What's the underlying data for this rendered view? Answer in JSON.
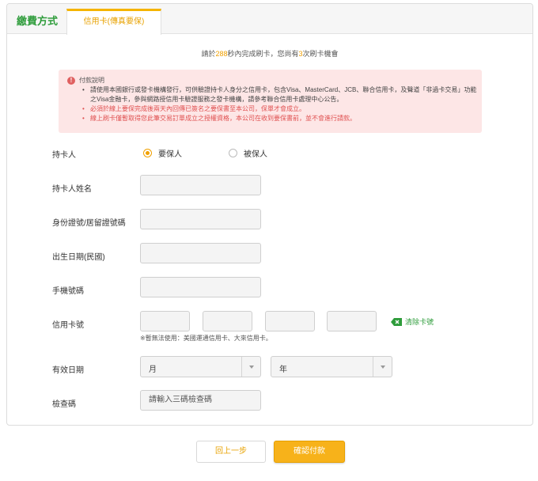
{
  "header": {
    "title": "繳費方式",
    "active_tab": "信用卡(傳真要保)"
  },
  "countdown": {
    "prefix": "請於",
    "seconds": "288",
    "middle": "秒內完成刷卡，您尚有",
    "attempts": "3",
    "suffix": "次刷卡機會"
  },
  "notice": {
    "icon": "exclamation-icon",
    "title": "付款說明",
    "items": [
      "請使用本國銀行或發卡機構發行，可供驗證持卡人身分之信用卡，包含Visa、MasterCard、JCB、聯合信用卡，及聲道「非過卡交易」功能之Visa金融卡，參與網路授信用卡驗證服務之發卡機構，請參考聯合信用卡處理中心公告。",
      "必須於線上要保完成後兩天內回傳已簽名之要保書至本公司，保單才會成立。",
      "線上刷卡僅暫取得您此筆交易訂單成立之授權資格，本公司在收到要保書前，並不會進行請款。"
    ]
  },
  "form": {
    "cardholder_label": "持卡人",
    "radio_options": [
      "要保人",
      "被保人"
    ],
    "selected_radio": "要保人",
    "name_label": "持卡人姓名",
    "id_label": "身份證號/居留證號碼",
    "birthday_label": "出生日期(民國)",
    "mobile_label": "手機號碼",
    "card_number_label": "信用卡號",
    "clear_card_label": "清除卡號",
    "card_note": "※暫無法使用：美國運通信用卡、大來信用卡。",
    "expiry_label": "有效日期",
    "month_select": "月",
    "year_select": "年",
    "cvv_label": "檢查碼",
    "cvv_placeholder": "請輸入三碼檢查碼"
  },
  "buttons": {
    "back": "回上一步",
    "confirm": "確認付款"
  },
  "colors": {
    "brand_green": "#2e9c3b",
    "accent_orange": "#f0a000",
    "notice_bg": "#fde6e6",
    "warn_red": "#e05050"
  }
}
